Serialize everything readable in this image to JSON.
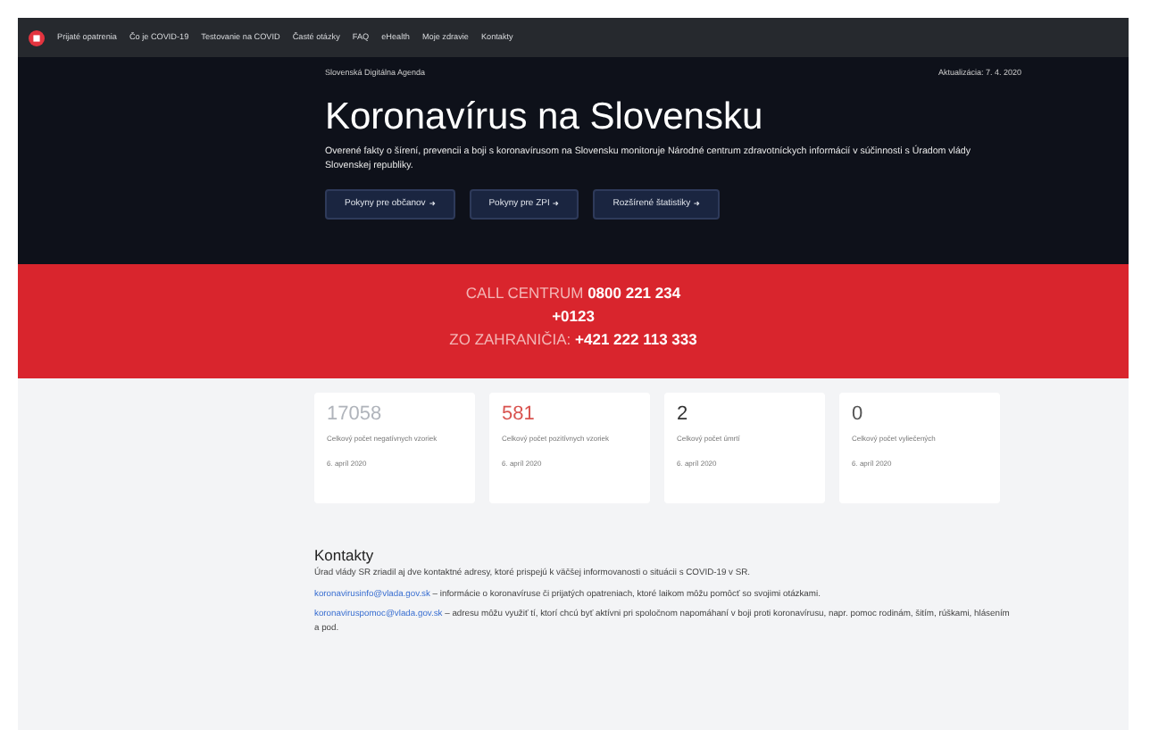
{
  "navbar": {
    "items": [
      {
        "label": "Prijaté opatrenia"
      },
      {
        "label": "Čo je COVID-19"
      },
      {
        "label": "Testovanie na COVID"
      },
      {
        "label": "Časté otázky"
      },
      {
        "label": "FAQ"
      },
      {
        "label": "eHealth"
      },
      {
        "label": "Moje zdravie"
      },
      {
        "label": "Kontakty"
      }
    ]
  },
  "hero": {
    "breadcrumb": "Slovenská Digitálna Agenda",
    "updated": "Aktualizácia: 7. 4. 2020",
    "title": "Koronavírus na Slovensku",
    "text": "Overené fakty o šírení, prevencii a boji s koronavírusom na Slovensku monitoruje Národné centrum zdravotníckych informácií v súčinnosti s Úradom vlády Slovenskej republiky.",
    "buttons": [
      {
        "label": "Pokyny pre občanov"
      },
      {
        "label": "Pokyny pre ZPI"
      },
      {
        "label": "Rozšírené štatistiky"
      }
    ]
  },
  "call_center": {
    "label": "CALL CENTRUM",
    "number": "0800 221 234",
    "extra": "+0123",
    "abroad_label": "ZO ZAHRANIČIA:",
    "abroad_number": "+421 222 113 333"
  },
  "stats": [
    {
      "value": "17058",
      "color": "#b0b4bb",
      "label": "Celkový počet negatívnych vzoriek",
      "date": "6. apríl 2020"
    },
    {
      "value": "581",
      "color": "#d9534f",
      "label": "Celkový počet pozitívnych vzoriek",
      "date": "6. apríl 2020"
    },
    {
      "value": "2",
      "color": "#333333",
      "label": "Celkový počet úmrtí",
      "date": "6. apríl 2020"
    },
    {
      "value": "0",
      "color": "#555555",
      "label": "Celkový počet vyliečených",
      "date": "6. apríl 2020"
    }
  ],
  "contacts": {
    "title": "Kontakty",
    "intro": "Úrad vlády SR zriadil aj dve kontaktné adresy, ktoré prispejú k väčšej informovanosti o situácii s COVID-19 v SR.",
    "items": [
      {
        "email": "koronavirusinfo@vlada.gov.sk",
        "text": " – informácie o koronavíruse či prijatých opatreniach, ktoré laikom môžu pomôcť so svojimi otázkami."
      },
      {
        "email": "koronaviruspomoc@vlada.gov.sk",
        "text": " – adresu môžu využiť tí, ktorí chcú byť aktívni pri spoločnom napomáhaní v boji proti koronavírusu, napr. pomoc rodinám, šitím, rúškami, hlásením a pod."
      }
    ]
  }
}
